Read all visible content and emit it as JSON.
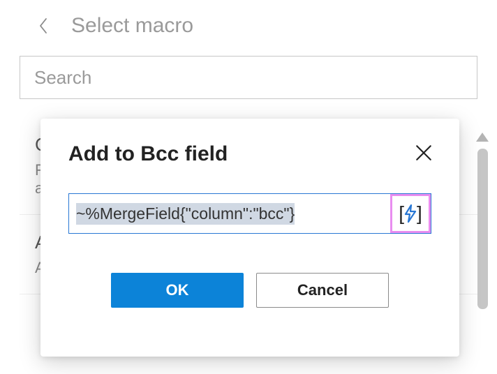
{
  "header": {
    "title": "Select macro"
  },
  "search": {
    "placeholder": "Search",
    "value": ""
  },
  "macros": [
    {
      "title": "C",
      "desc_line1": "F",
      "desc_line2": "a"
    },
    {
      "title": "A",
      "desc_line1": "A",
      "desc_line2": ""
    }
  ],
  "modal": {
    "title": "Add to Bcc field",
    "field_value": "~%MergeField{\"column\":\"bcc\"}",
    "ok_label": "OK",
    "cancel_label": "Cancel"
  }
}
